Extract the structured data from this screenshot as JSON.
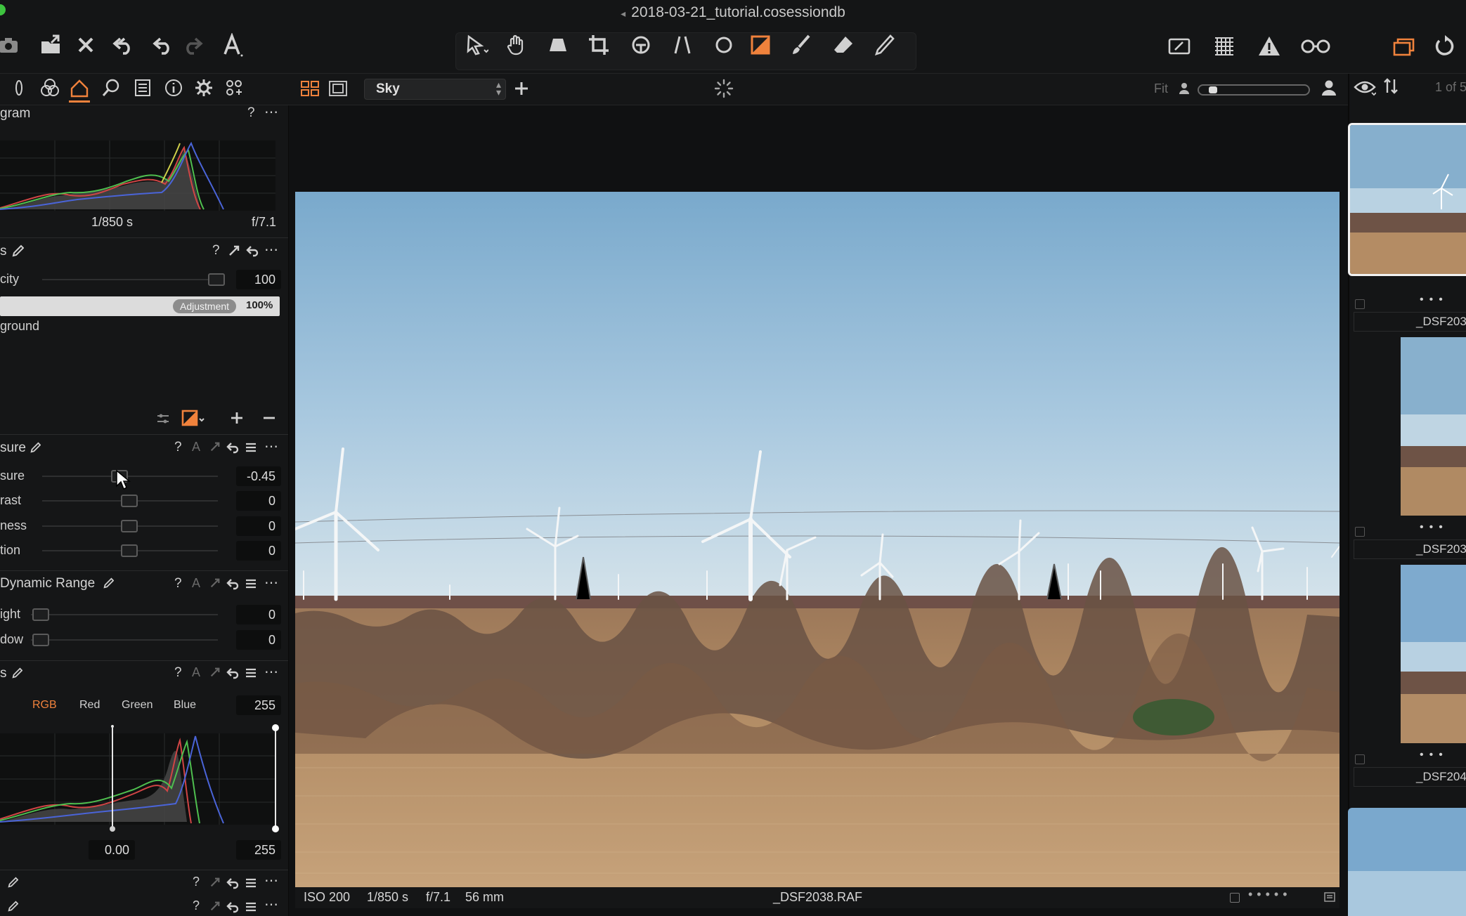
{
  "window": {
    "title": "2018-03-21_tutorial.cosessiondb"
  },
  "toolbar": {
    "left_icons": [
      "camera-icon",
      "import-icon",
      "delete-icon",
      "undo-all-icon",
      "undo-icon",
      "redo-icon",
      "text-icon"
    ],
    "center_icons": [
      "select-cursor-icon",
      "pan-hand-icon",
      "keystone-icon",
      "crop-icon",
      "rotate-icon",
      "straighten-icon",
      "circle-icon",
      "mask-icon",
      "brush-icon",
      "eraser-icon",
      "gradient-icon"
    ],
    "right_icons": [
      "edit-icon",
      "grid-icon",
      "warning-icon",
      "glasses-icon",
      "stack-icon",
      "reset-icon"
    ]
  },
  "viewer_header": {
    "mask_select": "Sky",
    "fit_label": "Fit",
    "counter": "1 of 5"
  },
  "histogram": {
    "title": "gram",
    "shutter": "1/850 s",
    "aperture": "f/7.1"
  },
  "layers": {
    "title": "s",
    "opacity_label": "city",
    "opacity_value": "100",
    "layer_adjustment_badge": "Adjustment",
    "layer_adjustment_percent": "100%",
    "background_label": "ground"
  },
  "exposure": {
    "title": "sure",
    "rows": [
      {
        "label": "sure",
        "value": "-0.45"
      },
      {
        "label": "rast",
        "value": "0"
      },
      {
        "label": "ness",
        "value": "0"
      },
      {
        "label": "tion",
        "value": "0"
      }
    ]
  },
  "hdr": {
    "title": "Dynamic Range",
    "rows": [
      {
        "label": "ight",
        "value": "0"
      },
      {
        "label": "dow",
        "value": "0"
      }
    ]
  },
  "levels": {
    "title": "s",
    "tabs": [
      "RGB",
      "Red",
      "Green",
      "Blue"
    ],
    "top_value": "255",
    "bottom_left": "0.00",
    "bottom_right": "255"
  },
  "viewer_info": {
    "iso": "ISO 200",
    "shutter": "1/850 s",
    "aperture": "f/7.1",
    "focal": "56 mm",
    "filename": "_DSF2038.RAF"
  },
  "browser": {
    "thumb_names": [
      "_DSF203",
      "_DSF203",
      "_DSF204"
    ]
  },
  "colors": {
    "accent": "#f0823c",
    "panel": "#151617",
    "background": "#101112"
  }
}
